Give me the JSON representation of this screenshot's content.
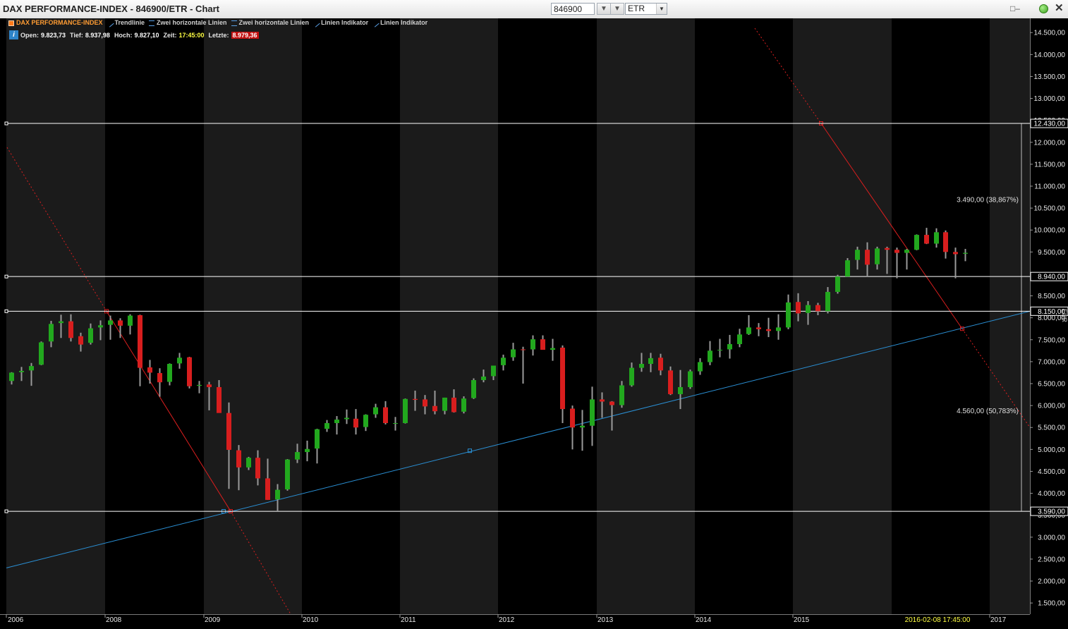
{
  "window": {
    "title": "DAX PERFORMANCE-INDEX - 846900/ETR - Chart",
    "symbol_value": "846900",
    "exchange_value": "ETR"
  },
  "legend": {
    "items": [
      {
        "label": "DAX PERFORMANCE-INDEX",
        "color": "#ff9c33",
        "icon": "square-icon"
      },
      {
        "label": "Trendlinie",
        "color": "#5aa0e6",
        "icon": "trendline-icon"
      },
      {
        "label": "Zwei horizontale Linien",
        "color": "#5aa0e6",
        "icon": "two-lines-icon"
      },
      {
        "label": "Zwei horizontale Linien",
        "color": "#5aa0e6",
        "icon": "two-lines-icon"
      },
      {
        "label": "Linien Indikator",
        "color": "#5aa0e6",
        "icon": "line-icon"
      },
      {
        "label": "Linien Indikator",
        "color": "#5aa0e6",
        "icon": "line-icon"
      }
    ]
  },
  "ohlc": {
    "open_label": "Open:",
    "open_value": "9.823,73",
    "low_label": "Tief:",
    "low_value": "8.937,98",
    "high_label": "Hoch:",
    "high_value": "9.827,10",
    "time_label": "Zeit:",
    "time_value": "17:45:00",
    "last_label": "Letzte:",
    "last_value": "8.979,36"
  },
  "chart_data": {
    "type": "candlestick",
    "title": "DAX PERFORMANCE-INDEX",
    "ylim": [
      1100,
      14600
    ],
    "y_ticks": [
      {
        "value": 1500,
        "label": "1.500,00"
      },
      {
        "value": 2000,
        "label": "2.000,00"
      },
      {
        "value": 2500,
        "label": "2.500,00"
      },
      {
        "value": 3000,
        "label": "3.000,00"
      },
      {
        "value": 3500,
        "label": "3.500,00"
      },
      {
        "value": 4000,
        "label": "4.000,00"
      },
      {
        "value": 4500,
        "label": "4.500,00"
      },
      {
        "value": 5000,
        "label": "5.000,00"
      },
      {
        "value": 5500,
        "label": "5.500,00"
      },
      {
        "value": 6000,
        "label": "6.000,00"
      },
      {
        "value": 6500,
        "label": "6.500,00"
      },
      {
        "value": 7000,
        "label": "7.000,00"
      },
      {
        "value": 7500,
        "label": "7.500,00"
      },
      {
        "value": 8000,
        "label": "8.000,00"
      },
      {
        "value": 8500,
        "label": "8.500,00"
      },
      {
        "value": 9500,
        "label": "9.500,00"
      },
      {
        "value": 10000,
        "label": "10.000,00"
      },
      {
        "value": 10500,
        "label": "10.500,00"
      },
      {
        "value": 11000,
        "label": "11.000,00"
      },
      {
        "value": 11500,
        "label": "11.500,00"
      },
      {
        "value": 12000,
        "label": "12.000,00"
      },
      {
        "value": 12500,
        "label": "12.500,00"
      },
      {
        "value": 13000,
        "label": "13.000,00"
      },
      {
        "value": 13500,
        "label": "13.500,00"
      },
      {
        "value": 14000,
        "label": "14.000,00"
      },
      {
        "value": 14500,
        "label": "14.500,00"
      }
    ],
    "x_ticks": [
      {
        "t": 0,
        "label": "2006"
      },
      {
        "t": 1,
        "label": "2008"
      },
      {
        "t": 2,
        "label": "2009"
      },
      {
        "t": 3,
        "label": "2010"
      },
      {
        "t": 4,
        "label": "2011"
      },
      {
        "t": 5,
        "label": "2012"
      },
      {
        "t": 6,
        "label": "2013"
      },
      {
        "t": 7,
        "label": "2014"
      },
      {
        "t": 8,
        "label": "2015"
      },
      {
        "t": 10,
        "label": "2017"
      }
    ],
    "cursor_time": "2016-02-08 17:45:00",
    "currency_label": "EUR",
    "horizontal_levels": [
      {
        "value": 12430,
        "label": "12.430,00"
      },
      {
        "value": 8940,
        "label": "8.940,00"
      },
      {
        "value": 8150,
        "label": "8.150,00"
      },
      {
        "value": 3590,
        "label": "3.590,00"
      }
    ],
    "measurements": [
      {
        "label": "3.490,00 (38,867%)",
        "from": 12430,
        "to": 8940
      },
      {
        "label": "4.560,00 (50,783%)",
        "from": 8150,
        "to": 3590
      }
    ],
    "up_color": "#22a81e",
    "down_color": "#d81e1e",
    "wick_color": "#9a9a9a",
    "candles": [
      {
        "t": 0.05,
        "o": 6560,
        "h": 6760,
        "l": 6480,
        "c": 6750
      },
      {
        "t": 0.15,
        "o": 6760,
        "h": 6880,
        "l": 6560,
        "c": 6790
      },
      {
        "t": 0.25,
        "o": 6800,
        "h": 6970,
        "l": 6450,
        "c": 6900
      },
      {
        "t": 0.35,
        "o": 6930,
        "h": 7460,
        "l": 6920,
        "c": 7440
      },
      {
        "t": 0.45,
        "o": 7460,
        "h": 7930,
        "l": 7330,
        "c": 7860
      },
      {
        "t": 0.55,
        "o": 7880,
        "h": 8070,
        "l": 7540,
        "c": 7920
      },
      {
        "t": 0.65,
        "o": 7920,
        "h": 8080,
        "l": 7460,
        "c": 7540
      },
      {
        "t": 0.75,
        "o": 7580,
        "h": 7660,
        "l": 7230,
        "c": 7390
      },
      {
        "t": 0.85,
        "o": 7430,
        "h": 7870,
        "l": 7390,
        "c": 7760
      },
      {
        "t": 0.95,
        "o": 7780,
        "h": 7940,
        "l": 7490,
        "c": 7830
      },
      {
        "t": 1.05,
        "o": 7840,
        "h": 8050,
        "l": 7500,
        "c": 7940
      },
      {
        "t": 1.15,
        "o": 7940,
        "h": 7990,
        "l": 7540,
        "c": 7820
      },
      {
        "t": 1.25,
        "o": 7820,
        "h": 8080,
        "l": 7620,
        "c": 8050
      },
      {
        "t": 1.35,
        "o": 8060,
        "h": 8070,
        "l": 6440,
        "c": 6860
      },
      {
        "t": 1.45,
        "o": 6870,
        "h": 7040,
        "l": 6500,
        "c": 6750
      },
      {
        "t": 1.55,
        "o": 6740,
        "h": 6850,
        "l": 6200,
        "c": 6530
      },
      {
        "t": 1.65,
        "o": 6540,
        "h": 6960,
        "l": 6460,
        "c": 6950
      },
      {
        "t": 1.75,
        "o": 6960,
        "h": 7200,
        "l": 6840,
        "c": 7090
      },
      {
        "t": 1.85,
        "o": 7100,
        "h": 7110,
        "l": 6390,
        "c": 6440
      },
      {
        "t": 1.95,
        "o": 6450,
        "h": 6560,
        "l": 6280,
        "c": 6470
      },
      {
        "t": 2.05,
        "o": 6480,
        "h": 6540,
        "l": 5890,
        "c": 6420
      },
      {
        "t": 2.15,
        "o": 6420,
        "h": 6580,
        "l": 5850,
        "c": 5830
      },
      {
        "t": 2.25,
        "o": 5830,
        "h": 6070,
        "l": 4100,
        "c": 4990
      },
      {
        "t": 2.35,
        "o": 4980,
        "h": 5100,
        "l": 4070,
        "c": 4590
      },
      {
        "t": 2.45,
        "o": 4590,
        "h": 4830,
        "l": 4530,
        "c": 4810
      },
      {
        "t": 2.55,
        "o": 4810,
        "h": 4980,
        "l": 4180,
        "c": 4340
      },
      {
        "t": 2.65,
        "o": 4340,
        "h": 4790,
        "l": 3850,
        "c": 3850
      },
      {
        "t": 2.75,
        "o": 3860,
        "h": 4210,
        "l": 3590,
        "c": 4080
      },
      {
        "t": 2.85,
        "o": 4090,
        "h": 4780,
        "l": 4060,
        "c": 4770
      },
      {
        "t": 2.95,
        "o": 4770,
        "h": 5130,
        "l": 4690,
        "c": 4940
      },
      {
        "t": 3.05,
        "o": 4940,
        "h": 5200,
        "l": 4730,
        "c": 5010
      },
      {
        "t": 3.15,
        "o": 5020,
        "h": 5470,
        "l": 4680,
        "c": 5460
      },
      {
        "t": 3.25,
        "o": 5470,
        "h": 5670,
        "l": 5400,
        "c": 5600
      },
      {
        "t": 3.35,
        "o": 5600,
        "h": 5760,
        "l": 5340,
        "c": 5680
      },
      {
        "t": 3.45,
        "o": 5690,
        "h": 5910,
        "l": 5580,
        "c": 5720
      },
      {
        "t": 3.55,
        "o": 5700,
        "h": 5920,
        "l": 5340,
        "c": 5500
      },
      {
        "t": 3.65,
        "o": 5510,
        "h": 5800,
        "l": 5420,
        "c": 5790
      },
      {
        "t": 3.75,
        "o": 5800,
        "h": 6040,
        "l": 5720,
        "c": 5960
      },
      {
        "t": 3.85,
        "o": 5960,
        "h": 6100,
        "l": 5570,
        "c": 5600
      },
      {
        "t": 3.95,
        "o": 5600,
        "h": 5740,
        "l": 5430,
        "c": 5600
      },
      {
        "t": 4.05,
        "o": 5600,
        "h": 6160,
        "l": 5590,
        "c": 6150
      },
      {
        "t": 4.15,
        "o": 6150,
        "h": 6340,
        "l": 5880,
        "c": 6130
      },
      {
        "t": 4.25,
        "o": 6140,
        "h": 6240,
        "l": 5800,
        "c": 5980
      },
      {
        "t": 4.35,
        "o": 5990,
        "h": 6340,
        "l": 5800,
        "c": 5870
      },
      {
        "t": 4.45,
        "o": 5880,
        "h": 6180,
        "l": 5800,
        "c": 6180
      },
      {
        "t": 4.55,
        "o": 6180,
        "h": 6370,
        "l": 5840,
        "c": 5850
      },
      {
        "t": 4.65,
        "o": 5860,
        "h": 6210,
        "l": 5820,
        "c": 6160
      },
      {
        "t": 4.75,
        "o": 6170,
        "h": 6620,
        "l": 6150,
        "c": 6580
      },
      {
        "t": 4.85,
        "o": 6580,
        "h": 6820,
        "l": 6530,
        "c": 6660
      },
      {
        "t": 4.95,
        "o": 6670,
        "h": 6900,
        "l": 6580,
        "c": 6910
      },
      {
        "t": 5.05,
        "o": 6920,
        "h": 7160,
        "l": 6800,
        "c": 7090
      },
      {
        "t": 5.15,
        "o": 7100,
        "h": 7430,
        "l": 7020,
        "c": 7280
      },
      {
        "t": 5.25,
        "o": 7280,
        "h": 7340,
        "l": 6500,
        "c": 7270
      },
      {
        "t": 5.35,
        "o": 7280,
        "h": 7600,
        "l": 7140,
        "c": 7510
      },
      {
        "t": 5.45,
        "o": 7510,
        "h": 7600,
        "l": 7280,
        "c": 7270
      },
      {
        "t": 5.55,
        "o": 7270,
        "h": 7520,
        "l": 7020,
        "c": 7310
      },
      {
        "t": 5.65,
        "o": 7320,
        "h": 7370,
        "l": 5600,
        "c": 5920
      },
      {
        "t": 5.75,
        "o": 5930,
        "h": 6000,
        "l": 5000,
        "c": 5500
      },
      {
        "t": 5.85,
        "o": 5500,
        "h": 5900,
        "l": 4970,
        "c": 5540
      },
      {
        "t": 5.95,
        "o": 5540,
        "h": 6430,
        "l": 5080,
        "c": 6140
      },
      {
        "t": 6.05,
        "o": 6140,
        "h": 6300,
        "l": 5720,
        "c": 6090
      },
      {
        "t": 6.15,
        "o": 6090,
        "h": 6100,
        "l": 5430,
        "c": 6010
      },
      {
        "t": 6.25,
        "o": 6010,
        "h": 6560,
        "l": 5950,
        "c": 6460
      },
      {
        "t": 6.35,
        "o": 6460,
        "h": 6980,
        "l": 6430,
        "c": 6860
      },
      {
        "t": 6.45,
        "o": 6860,
        "h": 7200,
        "l": 6770,
        "c": 6950
      },
      {
        "t": 6.55,
        "o": 6950,
        "h": 7200,
        "l": 6760,
        "c": 7080
      },
      {
        "t": 6.65,
        "o": 7090,
        "h": 7180,
        "l": 6690,
        "c": 6800
      },
      {
        "t": 6.75,
        "o": 6800,
        "h": 6890,
        "l": 6240,
        "c": 6260
      },
      {
        "t": 6.85,
        "o": 6260,
        "h": 6810,
        "l": 5920,
        "c": 6420
      },
      {
        "t": 6.95,
        "o": 6420,
        "h": 6820,
        "l": 6380,
        "c": 6780
      },
      {
        "t": 7.05,
        "o": 6780,
        "h": 7080,
        "l": 6700,
        "c": 6990
      },
      {
        "t": 7.15,
        "o": 6990,
        "h": 7470,
        "l": 6920,
        "c": 7250
      },
      {
        "t": 7.25,
        "o": 7260,
        "h": 7520,
        "l": 7100,
        "c": 7270
      },
      {
        "t": 7.35,
        "o": 7280,
        "h": 7610,
        "l": 7070,
        "c": 7400
      },
      {
        "t": 7.45,
        "o": 7400,
        "h": 7750,
        "l": 7330,
        "c": 7620
      },
      {
        "t": 7.55,
        "o": 7630,
        "h": 8060,
        "l": 7610,
        "c": 7780
      },
      {
        "t": 7.65,
        "o": 7780,
        "h": 7880,
        "l": 7580,
        "c": 7740
      },
      {
        "t": 7.75,
        "o": 7740,
        "h": 8000,
        "l": 7560,
        "c": 7700
      },
      {
        "t": 7.85,
        "o": 7700,
        "h": 8080,
        "l": 7500,
        "c": 7780
      },
      {
        "t": 7.95,
        "o": 7780,
        "h": 8530,
        "l": 7740,
        "c": 8350
      },
      {
        "t": 8.05,
        "o": 8360,
        "h": 8560,
        "l": 7920,
        "c": 8100
      },
      {
        "t": 8.15,
        "o": 8110,
        "h": 8380,
        "l": 7840,
        "c": 8290
      },
      {
        "t": 8.25,
        "o": 8290,
        "h": 8340,
        "l": 8060,
        "c": 8150
      },
      {
        "t": 8.35,
        "o": 8150,
        "h": 8700,
        "l": 8100,
        "c": 8590
      },
      {
        "t": 8.45,
        "o": 8590,
        "h": 8980,
        "l": 8550,
        "c": 8940
      },
      {
        "t": 8.55,
        "o": 8940,
        "h": 9360,
        "l": 8940,
        "c": 9310
      },
      {
        "t": 8.65,
        "o": 9320,
        "h": 9620,
        "l": 9100,
        "c": 9550
      },
      {
        "t": 8.75,
        "o": 9550,
        "h": 9720,
        "l": 8940,
        "c": 9210
      },
      {
        "t": 8.85,
        "o": 9220,
        "h": 9620,
        "l": 9100,
        "c": 9580
      },
      {
        "t": 8.95,
        "o": 9590,
        "h": 9620,
        "l": 9000,
        "c": 9550
      },
      {
        "t": 9.05,
        "o": 9550,
        "h": 9600,
        "l": 8900,
        "c": 9480
      },
      {
        "t": 9.15,
        "o": 9480,
        "h": 9570,
        "l": 9100,
        "c": 9550
      },
      {
        "t": 9.25,
        "o": 9550,
        "h": 9900,
        "l": 9540,
        "c": 9890
      },
      {
        "t": 9.35,
        "o": 9890,
        "h": 10050,
        "l": 9680,
        "c": 9690
      },
      {
        "t": 9.45,
        "o": 9690,
        "h": 10040,
        "l": 9600,
        "c": 9950
      },
      {
        "t": 9.55,
        "o": 9950,
        "h": 9990,
        "l": 9350,
        "c": 9500
      },
      {
        "t": 9.65,
        "o": 9500,
        "h": 9600,
        "l": 8900,
        "c": 9450
      },
      {
        "t": 9.75,
        "o": 9460,
        "h": 9570,
        "l": 9290,
        "c": 9480
      }
    ]
  }
}
